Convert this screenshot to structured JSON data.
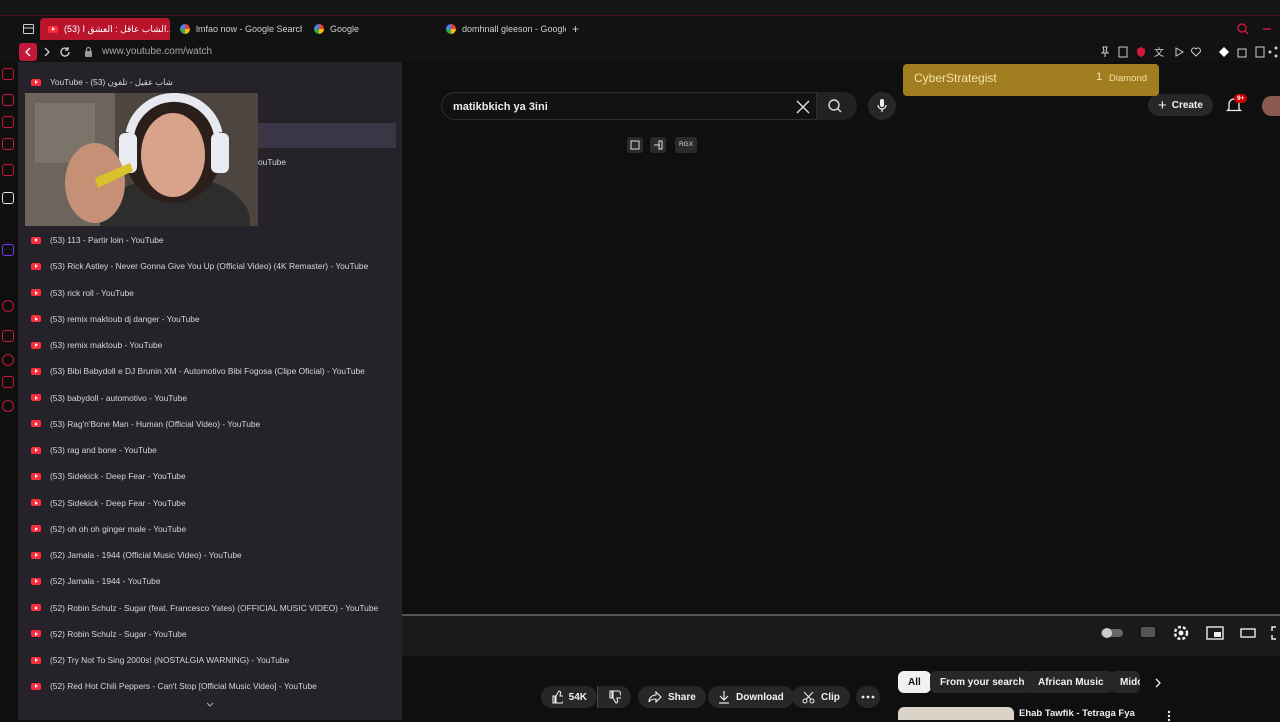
{
  "tabs": [
    {
      "label": "(53) الشاب عاقل : العشق ا...",
      "active": true
    },
    {
      "label": "lmfao now - Google Search"
    },
    {
      "label": "Google"
    },
    {
      "label": "domhnall gleeson - Google"
    }
  ],
  "new_tab_symbol": "+",
  "address": {
    "url": "www.youtube.com/watch"
  },
  "history_panel": {
    "header": "YouTube - شاب عقيل - تلفون (53)",
    "partial_item": "ouTube",
    "items": [
      "(53) 113 - Partir loin - YouTube",
      "(53) Rick Astley - Never Gonna Give You Up (Official Video) (4K Remaster) - YouTube",
      "(53) rick roll - YouTube",
      "(53) remix maktoub dj danger - YouTube",
      "(53) remix maktoub - YouTube",
      "(53) Bibi Babydoll e DJ Brunin XM - Automotivo Bibi Fogosa (Clipe Oficial) - YouTube",
      "(53) babydoll - automotivo - YouTube",
      "(53) Rag'n'Bone Man - Human (Official Video) - YouTube",
      "(53) rag and bone - YouTube",
      "(53) Sidekick - Deep Fear - YouTube",
      "(52) Sidekick - Deep Fear - YouTube",
      "(52) oh oh oh ginger male - YouTube",
      "(52) Jamala - 1944 (Official Music Video) - YouTube",
      "(52) Jamala - 1944 - YouTube",
      "(52) Robin Schulz - Sugar (feat. Francesco Yates) (OFFICIAL MUSIC VIDEO) - YouTube",
      "(52) Robin Schulz - Sugar - YouTube",
      "(52) Try Not To Sing 2000s! (NOSTALGIA WARNING) - YouTube",
      "(52) Red Hot Chili Peppers - Can't Stop [Official Music Video] - YouTube"
    ]
  },
  "overlay": {
    "name": "CyberStrategist",
    "gift_count": "1",
    "gift_name": "Diamond"
  },
  "youtube": {
    "search_value": "matikbkich ya 3ini",
    "search_tool_label": "RGX",
    "create_label": "Create",
    "notifications_badge": "9+",
    "actions": {
      "likes": "54K",
      "share": "Share",
      "download": "Download",
      "clip": "Clip"
    },
    "chips": [
      "All",
      "From your search",
      "African Music",
      "Midc"
    ],
    "related_title": "Ehab Tawfik - Tetraga Fya"
  },
  "colors": {
    "accent": "#b8142c",
    "youtube_red": "#ff2d3b",
    "overlay_bg": "#c9a02a",
    "history_bg": "#252329"
  }
}
